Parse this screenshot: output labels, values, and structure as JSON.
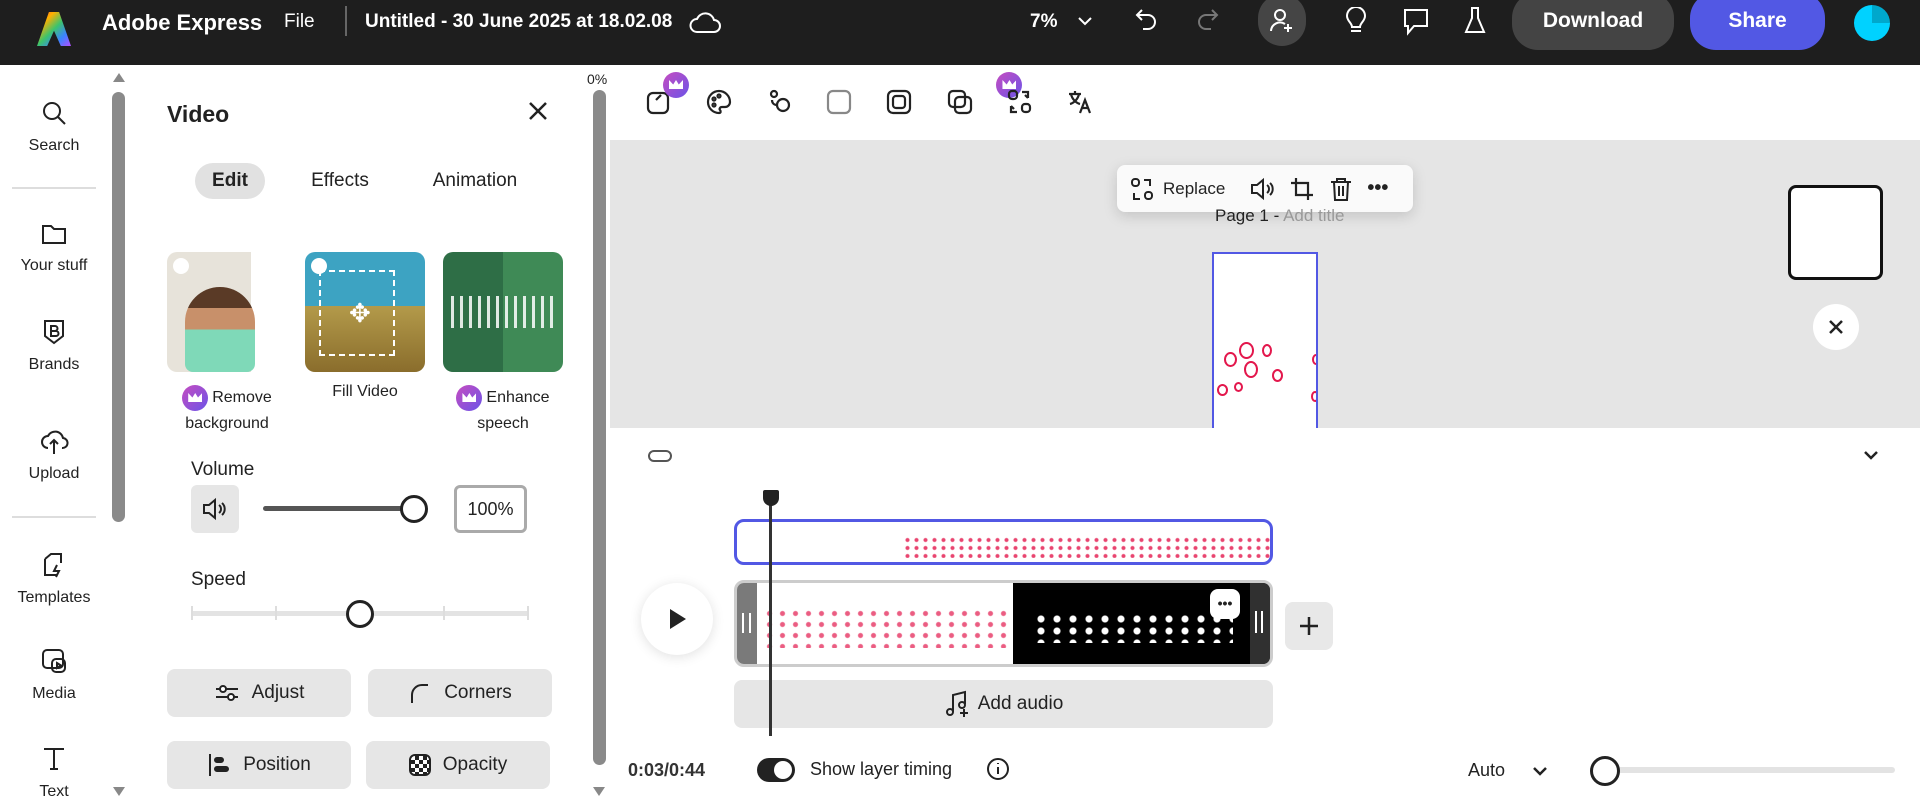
{
  "header": {
    "app_name": "Adobe Express",
    "file_menu": "File",
    "doc_title": "Untitled - 30 June 2025 at 18.02.08",
    "zoom": "7%",
    "download": "Download",
    "share": "Share"
  },
  "rail": {
    "items": [
      {
        "label": "Search"
      },
      {
        "label": "Your stuff"
      },
      {
        "label": "Brands"
      },
      {
        "label": "Upload"
      },
      {
        "label": "Templates"
      },
      {
        "label": "Media"
      },
      {
        "label": "Text"
      }
    ]
  },
  "panel": {
    "title": "Video",
    "scroll_percent": "0%",
    "tabs": [
      {
        "label": "Edit"
      },
      {
        "label": "Effects"
      },
      {
        "label": "Animation"
      }
    ],
    "cards": [
      {
        "label_1": "Remove",
        "label_2": "background",
        "premium": true
      },
      {
        "label_1": "Fill Video",
        "premium": false
      },
      {
        "label_1": "Enhance",
        "label_2": "speech",
        "premium": true
      }
    ],
    "volume_label": "Volume",
    "volume_value": "100%",
    "volume_fraction": 1.0,
    "speed_label": "Speed",
    "speed_fraction": 0.5,
    "buttons": [
      {
        "label": "Adjust"
      },
      {
        "label": "Corners"
      },
      {
        "label": "Position"
      },
      {
        "label": "Opacity"
      }
    ]
  },
  "canvas": {
    "float_toolbar": {
      "replace": "Replace"
    },
    "page_label": "Page 1 -",
    "page_title_placeholder": "Add title"
  },
  "timeline": {
    "add_audio": "Add audio",
    "time": "0:03/0:44",
    "show_layer_timing": "Show layer timing",
    "zoom_mode": "Auto",
    "zoom_fraction": 0.05
  },
  "colors": {
    "accent": "#5258e4",
    "header_bg": "#1e1e1e",
    "heart": "#e3174c"
  }
}
